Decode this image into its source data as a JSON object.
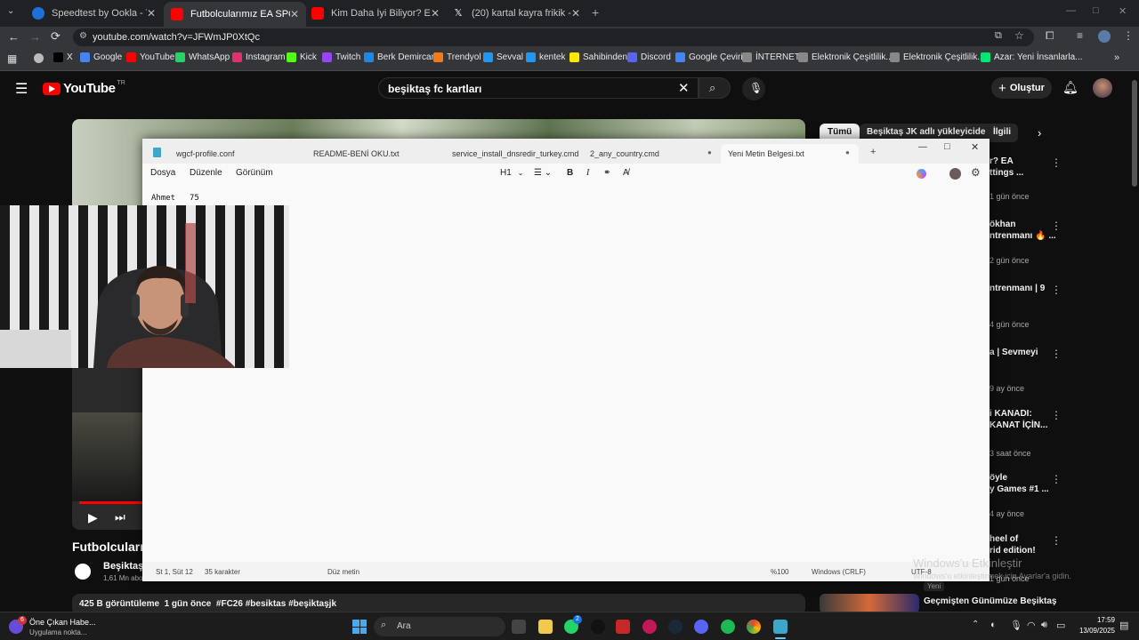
{
  "browser": {
    "tabs": [
      {
        "title": "Speedtest by Ookla - The Glob",
        "color": "#1e6fd9"
      },
      {
        "title": "Futbolcularımız EA SPORTS FC",
        "color": "#ff0000"
      },
      {
        "title": "Kim Daha İyi Biliyor? EA SPORT",
        "color": "#ff0000"
      },
      {
        "title": "(20) kartal kayra frikik - Arama",
        "color": "#000000"
      }
    ],
    "url": "youtube.com/watch?v=JFWmJP0XtQc",
    "bookmarks": [
      {
        "label": "X",
        "color": "#000"
      },
      {
        "label": "Google",
        "color": "#4285f4"
      },
      {
        "label": "YouTube",
        "color": "#ff0000"
      },
      {
        "label": "WhatsApp",
        "color": "#25d366"
      },
      {
        "label": "Instagram",
        "color": "#e1306c"
      },
      {
        "label": "Kick",
        "color": "#53fc18"
      },
      {
        "label": "Twitch",
        "color": "#9146ff"
      },
      {
        "label": "Berk Demircan",
        "color": "#1e88e5"
      },
      {
        "label": "Trendyol",
        "color": "#f27a1a"
      },
      {
        "label": "Sevval",
        "color": "#2196f3"
      },
      {
        "label": "kentek",
        "color": "#2196f3"
      },
      {
        "label": "Sahibinden",
        "color": "#ffe800"
      },
      {
        "label": "Discord",
        "color": "#5865f2"
      },
      {
        "label": "Google Çeviri",
        "color": "#4285f4"
      },
      {
        "label": "İNTERNET",
        "color": "#888"
      },
      {
        "label": "Elektronik Çeşitlilik...",
        "color": "#888"
      },
      {
        "label": "Elektronik Çeşitlilik...",
        "color": "#888"
      },
      {
        "label": "Azar: Yeni İnsanlarla...",
        "color": "#00e676"
      }
    ]
  },
  "youtube": {
    "logo": "YouTube",
    "region": "TR",
    "search_value": "beşiktaş fc kartları",
    "create_label": "Oluştur",
    "chips": [
      "Tümü",
      "Beşiktaş JK adlı yükleyiciden",
      "İlgili"
    ],
    "video_title": "Futbolcularım",
    "channel_name": "Beşiktaş",
    "subscribers": "1,61 Mn abo",
    "description": "425 B görüntüleme  1 gün önce  #FC26 #besiktas #beşiktaşjk",
    "sidebar": [
      {
        "title": "r? EA\nttings ...",
        "meta": "1 gün önce"
      },
      {
        "title": "ökhan\nntrenmanı 🔥 ...",
        "meta": "2 gün önce"
      },
      {
        "title": "ntrenmanı | 9",
        "meta": "4 gün önce"
      },
      {
        "title": "a | Sevmeyi",
        "meta": "9 ay önce"
      },
      {
        "title": "i KANADI:\nKANAT İÇİN...",
        "meta": "3 saat önce"
      },
      {
        "title": "öyle\ny Games #1 ...",
        "meta": "4 ay önce"
      },
      {
        "title": "heel of\nrid edition!",
        "meta": "1 gün önce"
      },
      {
        "title": "Geçmişten Günümüze Beşiktaş",
        "meta": "Yeni"
      }
    ]
  },
  "notepad": {
    "tabs": [
      "wgcf-profile.conf",
      "README-BENİ OKU.txt",
      "service_install_dnsredir_turkey.cmd",
      "2_any_country.cmd",
      "Yeni Metin Belgesi.txt"
    ],
    "menu": [
      "Dosya",
      "Düzenle",
      "Görünüm"
    ],
    "heading": "H1",
    "content_name": "Ahmet",
    "content_value": "75",
    "status": {
      "position": "St 1, Süt 12",
      "chars": "35 karakter",
      "mode": "Düz metin",
      "zoom": "%100",
      "eol": "Windows (CRLF)",
      "encoding": "UTF-8"
    }
  },
  "watermark": {
    "title": "Windows'u Etkinleştir",
    "subtitle": "Windows'u etkinleştirmek için Ayarlar'a gidin."
  },
  "taskbar": {
    "news_title": "Öne Çıkan Habe...",
    "news_sub": "Uygulama nokta...",
    "badge": "6",
    "search": "Ara",
    "whatsapp_badge": "2",
    "time": "17:59",
    "date": "13/09/2025"
  }
}
